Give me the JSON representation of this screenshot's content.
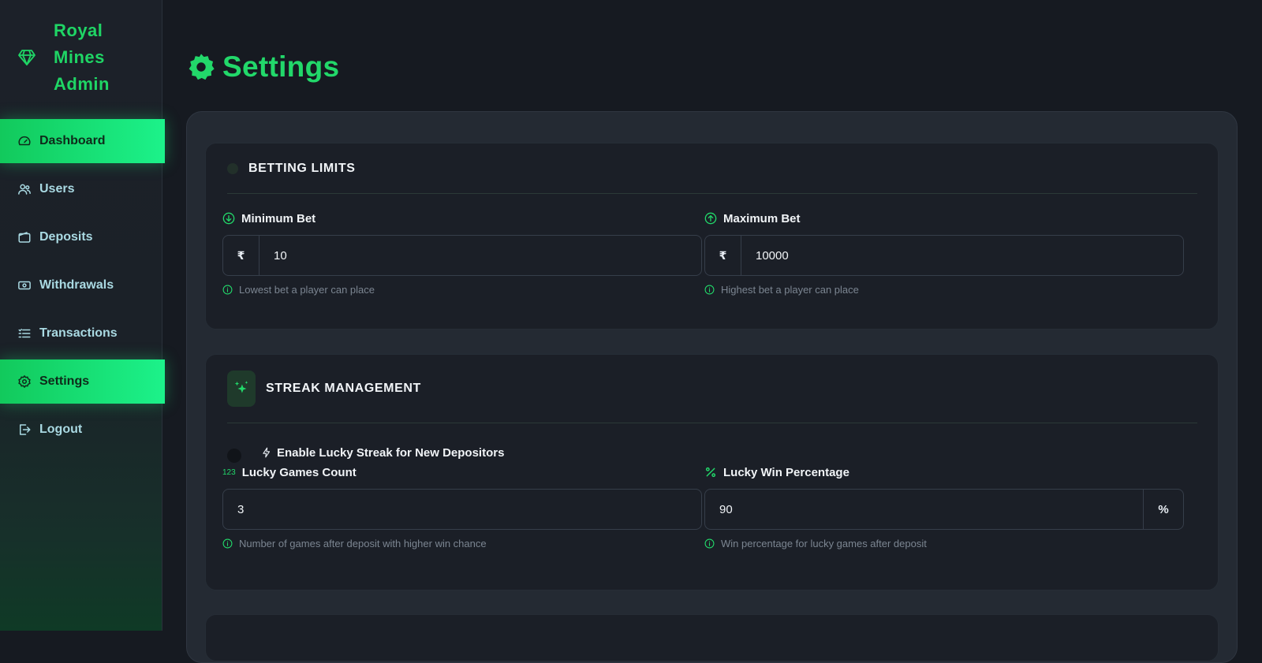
{
  "sidebar": {
    "brand": "Royal Mines Admin",
    "brand_icon": "diamond-icon",
    "items": [
      {
        "label": "Dashboard",
        "icon": "speedometer-icon",
        "active": true
      },
      {
        "label": "Users",
        "icon": "users-icon",
        "active": false
      },
      {
        "label": "Deposits",
        "icon": "wallet-icon",
        "active": false
      },
      {
        "label": "Withdrawals",
        "icon": "cash-icon",
        "active": false
      },
      {
        "label": "Transactions",
        "icon": "list-icon",
        "active": false
      },
      {
        "label": "Settings",
        "icon": "gear-icon",
        "active": true
      },
      {
        "label": "Logout",
        "icon": "logout-icon",
        "active": false
      }
    ]
  },
  "header": {
    "title": "Settings",
    "icon": "gear-icon"
  },
  "betting_limits": {
    "title": "BETTING LIMITS",
    "min_bet": {
      "label": "Minimum Bet",
      "prefix": "₹",
      "value": "10",
      "hint": "Lowest bet a player can place"
    },
    "max_bet": {
      "label": "Maximum Bet",
      "prefix": "₹",
      "value": "10000",
      "hint": "Highest bet a player can place"
    }
  },
  "streak_management": {
    "title": "STREAK MANAGEMENT",
    "toggle_label": "Enable Lucky Streak for New Depositors",
    "lucky_games": {
      "label": "Lucky Games Count",
      "label_badge": "123",
      "value": "3",
      "hint": "Number of games after deposit with higher win chance"
    },
    "lucky_win": {
      "label": "Lucky Win Percentage",
      "suffix": "%",
      "value": "90",
      "hint": "Win percentage for lucky games after deposit"
    }
  },
  "colors": {
    "accent": "#22d86a",
    "active_gradient_start": "#12c95c",
    "active_gradient_end": "#1cf28a",
    "background": "#161a21",
    "panel": "#242a33",
    "card": "#1b1f27"
  }
}
